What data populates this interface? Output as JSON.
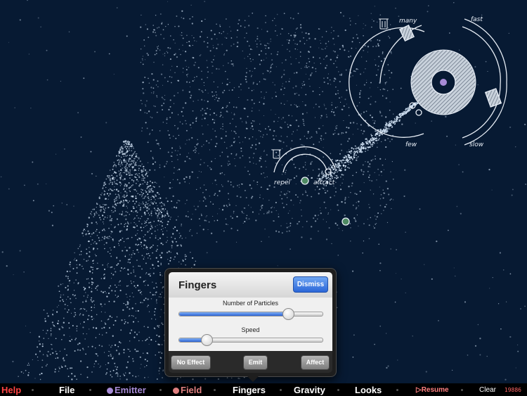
{
  "popover": {
    "title": "Fingers",
    "dismiss_label": "Dismiss",
    "sliders": [
      {
        "label": "Number of Particles",
        "value": 0.76
      },
      {
        "label": "Speed",
        "value": 0.19
      }
    ],
    "buttons": [
      "No Effect",
      "Emit",
      "Affect"
    ]
  },
  "canvas": {
    "emitter_labels": {
      "many": "many",
      "few": "few",
      "fast": "fast",
      "slow": "slow"
    },
    "field_labels": {
      "repel": "repel",
      "attract": "attract"
    }
  },
  "toolbar": {
    "help": "Help",
    "file": "File",
    "emitter": "Emitter",
    "field": "Field",
    "fingers": "Fingers",
    "gravity": "Gravity",
    "looks": "Looks",
    "resume": "Resume",
    "clear": "Clear",
    "count": "19886"
  },
  "colors": {
    "background": "#071a33",
    "help": "#ff4444",
    "emitter": "#a78bd6",
    "field": "#e08080",
    "resume": "#ff8080",
    "accent": "#2b66d8"
  }
}
